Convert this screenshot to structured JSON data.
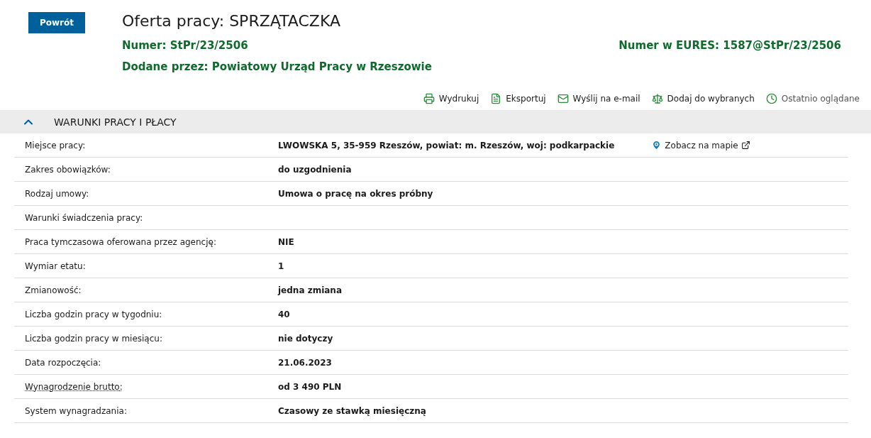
{
  "back_button": "Powrót",
  "title": "Oferta pracy: SPRZĄTACZKA",
  "number": "Numer: StPr/23/2506",
  "eures_number": "Numer w EURES: 1587@StPr/23/2506",
  "added_by": "Dodane przez: Powiatowy Urząd Pracy w Rzeszowie",
  "actions": [
    {
      "kind": "print",
      "label": "Wydrukuj"
    },
    {
      "kind": "export",
      "label": "Eksportuj"
    },
    {
      "kind": "email",
      "label": "Wyślij na e-mail"
    },
    {
      "kind": "favorite",
      "label": "Dodaj do wybranych"
    },
    {
      "kind": "history",
      "label": "Ostatnio oglądane"
    }
  ],
  "section": {
    "title": "WARUNKI PRACY I PŁACY",
    "expanded": true,
    "rows": [
      {
        "label": "Miejsce pracy:",
        "value": "LWOWSKA 5, 35-959 Rzeszów, powiat: m. Rzeszów, woj: podkarpackie",
        "map_link": "Zobacz na mapie",
        "hint": false
      },
      {
        "label": "Zakres obowiązków:",
        "value": "do uzgodnienia",
        "hint": false
      },
      {
        "label": "Rodzaj umowy:",
        "value": "Umowa o pracę na okres próbny",
        "hint": false
      },
      {
        "label": "Warunki świadczenia pracy:",
        "hint": false
      },
      {
        "label": "Praca tymczasowa oferowana przez agencję:",
        "value": "NIE",
        "hint": false
      },
      {
        "label": "Wymiar etatu:",
        "value": "1",
        "hint": false
      },
      {
        "label": "Zmianowość:",
        "value": "jedna zmiana",
        "hint": false
      },
      {
        "label": "Liczba godzin pracy w tygodniu:",
        "value": "40",
        "hint": false
      },
      {
        "label": "Liczba godzin pracy w miesiącu:",
        "value": "nie dotyczy",
        "hint": false
      },
      {
        "label": "Data rozpoczęcia:",
        "value": "21.06.2023",
        "hint": false
      },
      {
        "label": "Wynagrodzenie brutto",
        "suffix": ":",
        "value": "od 3 490 PLN",
        "hint": true
      },
      {
        "label": "System wynagradzania:",
        "value": "Czasowy ze stawką miesięczną",
        "hint": false
      }
    ]
  }
}
